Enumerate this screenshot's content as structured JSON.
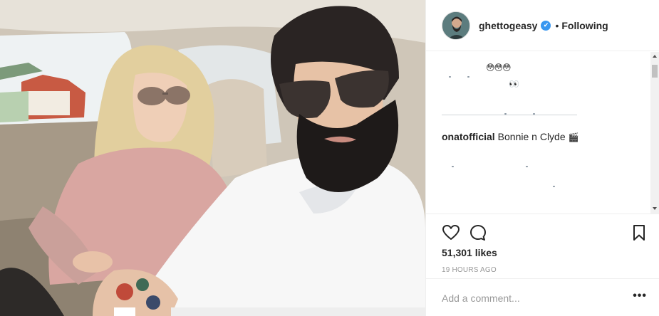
{
  "post": {
    "username": "ghettogeasy",
    "verified_mark": "✔",
    "separator": "•",
    "follow_status": "Following",
    "likes": "51,301 likes",
    "time": "19 HOURS AGO"
  },
  "comments": {
    "emoji_line_1": "😳😳😳",
    "emoji_line_2": "👀",
    "caption_user": "onatofficial",
    "caption_text": "Bonnie n Clyde",
    "caption_emoji": "🎬"
  },
  "comment_input": {
    "placeholder": "Add a comment..."
  },
  "more_label": "•••",
  "icons": {
    "like": "heart-icon",
    "comment": "speech-bubble-icon",
    "save": "bookmark-icon",
    "verified": "verified-badge-icon",
    "more": "more-options-icon"
  },
  "colors": {
    "verified_blue": "#3897f0",
    "divider": "#efefef",
    "muted_text": "#999999",
    "primary_text": "#262626"
  }
}
